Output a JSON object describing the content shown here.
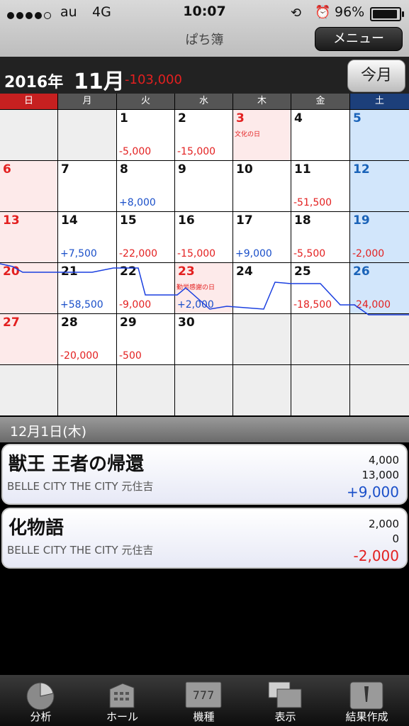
{
  "status_bar": {
    "carrier": "au",
    "network": "4G",
    "time": "10:07",
    "battery": "96%",
    "signal_icon": "signal-dots-icon",
    "lock_icon": "rotation-lock-icon",
    "alarm_icon": "alarm-icon"
  },
  "nav": {
    "title": "ぱち簿",
    "menu_label": "メニュー"
  },
  "month_header": {
    "year": "2016年",
    "month": "11月",
    "total": "-103,000",
    "today_label": "今月"
  },
  "weekdays": [
    "日",
    "月",
    "火",
    "水",
    "木",
    "金",
    "土"
  ],
  "calendar": {
    "weeks": [
      [
        {
          "day": "",
          "blank": true
        },
        {
          "day": "",
          "blank": true
        },
        {
          "day": "1",
          "amount": "-5,000"
        },
        {
          "day": "2",
          "amount": "-15,000"
        },
        {
          "day": "3",
          "holiday": "文化の日"
        },
        {
          "day": "4"
        },
        {
          "day": "5"
        }
      ],
      [
        {
          "day": "6"
        },
        {
          "day": "7"
        },
        {
          "day": "8",
          "amount": "+8,000"
        },
        {
          "day": "9"
        },
        {
          "day": "10"
        },
        {
          "day": "11",
          "amount": "-51,500"
        },
        {
          "day": "12"
        }
      ],
      [
        {
          "day": "13"
        },
        {
          "day": "14",
          "amount": "+7,500"
        },
        {
          "day": "15",
          "amount": "-22,000"
        },
        {
          "day": "16",
          "amount": "-15,000"
        },
        {
          "day": "17",
          "amount": "+9,000"
        },
        {
          "day": "18",
          "amount": "-5,500"
        },
        {
          "day": "19",
          "amount": "-2,000"
        }
      ],
      [
        {
          "day": "20"
        },
        {
          "day": "21",
          "amount": "+58,500"
        },
        {
          "day": "22",
          "amount": "-9,000"
        },
        {
          "day": "23",
          "amount": "+2,000",
          "holiday": "勤労感謝の日"
        },
        {
          "day": "24"
        },
        {
          "day": "25",
          "amount": "-18,500"
        },
        {
          "day": "26",
          "amount": "-24,000"
        }
      ],
      [
        {
          "day": "27"
        },
        {
          "day": "28",
          "amount": "-20,000"
        },
        {
          "day": "29",
          "amount": "-500"
        },
        {
          "day": "30"
        },
        {
          "day": "",
          "blank": true
        },
        {
          "day": "",
          "blank": true
        },
        {
          "day": "",
          "blank": true
        }
      ],
      [
        {
          "day": "",
          "blank": true
        },
        {
          "day": "",
          "blank": true
        },
        {
          "day": "",
          "blank": true
        },
        {
          "day": "",
          "blank": true
        },
        {
          "day": "",
          "blank": true
        },
        {
          "day": "",
          "blank": true
        },
        {
          "day": "",
          "blank": true
        }
      ]
    ]
  },
  "selected_date": "12月1日(木)",
  "entries": [
    {
      "machine": "獣王 王者の帰還",
      "hall": "BELLE CITY THE CITY 元住吉",
      "investment": "4,000",
      "payout": "13,000",
      "result": "+9,000"
    },
    {
      "machine": "化物語",
      "hall": "BELLE CITY THE CITY 元住吉",
      "investment": "2,000",
      "payout": "0",
      "result": "-2,000"
    }
  ],
  "tabs": [
    {
      "label": "分析",
      "icon": "pie-chart-icon"
    },
    {
      "label": "ホール",
      "icon": "building-icon"
    },
    {
      "label": "機種",
      "icon": "slot-machine-icon"
    },
    {
      "label": "表示",
      "icon": "view-icon"
    },
    {
      "label": "結果作成",
      "icon": "edit-icon"
    }
  ],
  "colors": {
    "positive": "#1a4fc9",
    "negative": "#e32020",
    "sunday": "#c62020",
    "saturday": "#1c3f7a",
    "trend_line": "#1a3fe0"
  }
}
